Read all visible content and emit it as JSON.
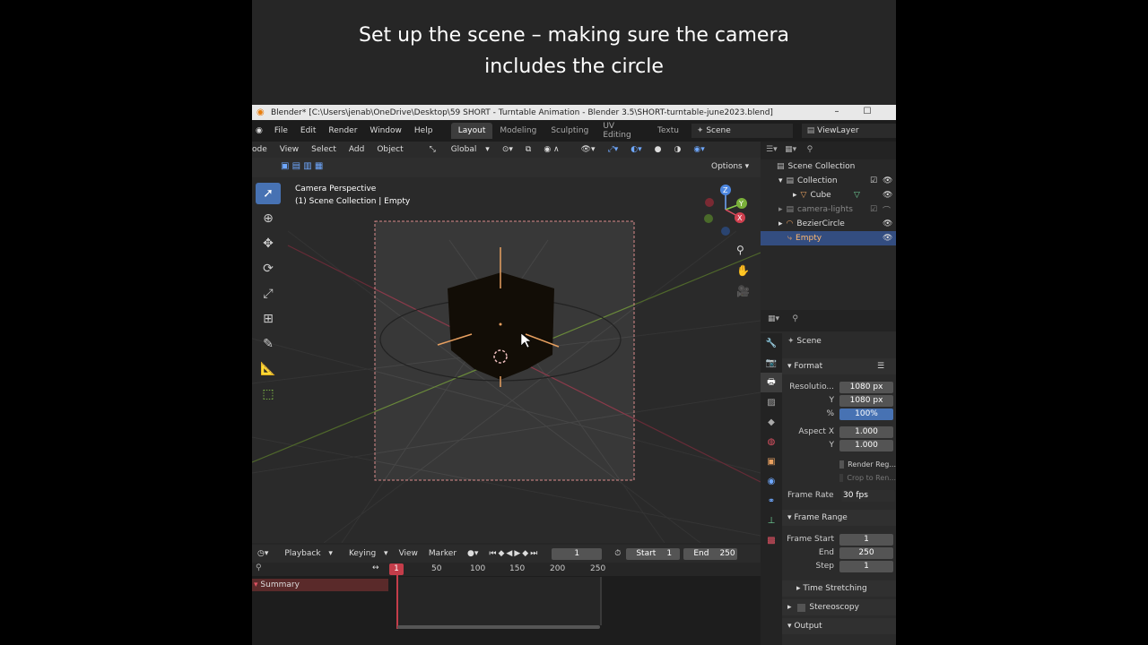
{
  "caption": {
    "line1": "Set up the scene – making sure the camera",
    "line2": "includes the circle"
  },
  "window": {
    "title": "Blender* [C:\\Users\\jenab\\OneDrive\\Desktop\\59 SHORT - Turntable Animation - Blender 3.5\\SHORT-turntable-june2023.blend]"
  },
  "menu": [
    "File",
    "Edit",
    "Render",
    "Window",
    "Help"
  ],
  "workspaces": {
    "items": [
      "Layout",
      "Modeling",
      "Sculpting",
      "UV Editing",
      "Textu"
    ],
    "active": "Layout"
  },
  "scene_name": "Scene",
  "view_layer": "ViewLayer",
  "viewport_header": {
    "mode": "ode",
    "items": [
      "View",
      "Select",
      "Add",
      "Object"
    ],
    "transform": "Global",
    "options": "Options"
  },
  "viewport_info": {
    "view": "Camera Perspective",
    "context": "(1) Scene Collection | Empty"
  },
  "outliner": {
    "items": [
      {
        "label": "Scene Collection",
        "level": 0
      },
      {
        "label": "Collection",
        "level": 1
      },
      {
        "label": "Cube",
        "level": 2
      },
      {
        "label": "camera-lights",
        "level": 1
      },
      {
        "label": "BezierCircle",
        "level": 1
      },
      {
        "label": "Empty",
        "level": 1,
        "selected": true
      }
    ]
  },
  "properties": {
    "header": "Scene",
    "format_label": "Format",
    "resolution_x_label": "Resolutio...",
    "resolution_x": "1080 px",
    "resolution_y_label": "Y",
    "resolution_y": "1080 px",
    "percent_label": "%",
    "percent": "100%",
    "aspect_x_label": "Aspect X",
    "aspect_x": "1.000",
    "aspect_y_label": "Y",
    "aspect_y": "1.000",
    "render_region": "Render Reg...",
    "crop_to_render": "Crop to Ren...",
    "frame_rate_label": "Frame Rate",
    "frame_rate": "30 fps",
    "frame_range_label": "Frame Range",
    "frame_start_label": "Frame Start",
    "frame_start": "1",
    "end_label": "End",
    "end": "250",
    "step_label": "Step",
    "step": "1",
    "time_stretching": "Time Stretching",
    "stereoscopy": "Stereoscopy",
    "output": "Output"
  },
  "timeline": {
    "menu": [
      "Playback",
      "Keying",
      "View",
      "Marker"
    ],
    "current_frame": "1",
    "start_label": "Start",
    "start": "1",
    "end_label": "End",
    "end": "250",
    "ruler": [
      "1",
      "50",
      "100",
      "150",
      "200",
      "250"
    ],
    "summary": "Summary"
  }
}
